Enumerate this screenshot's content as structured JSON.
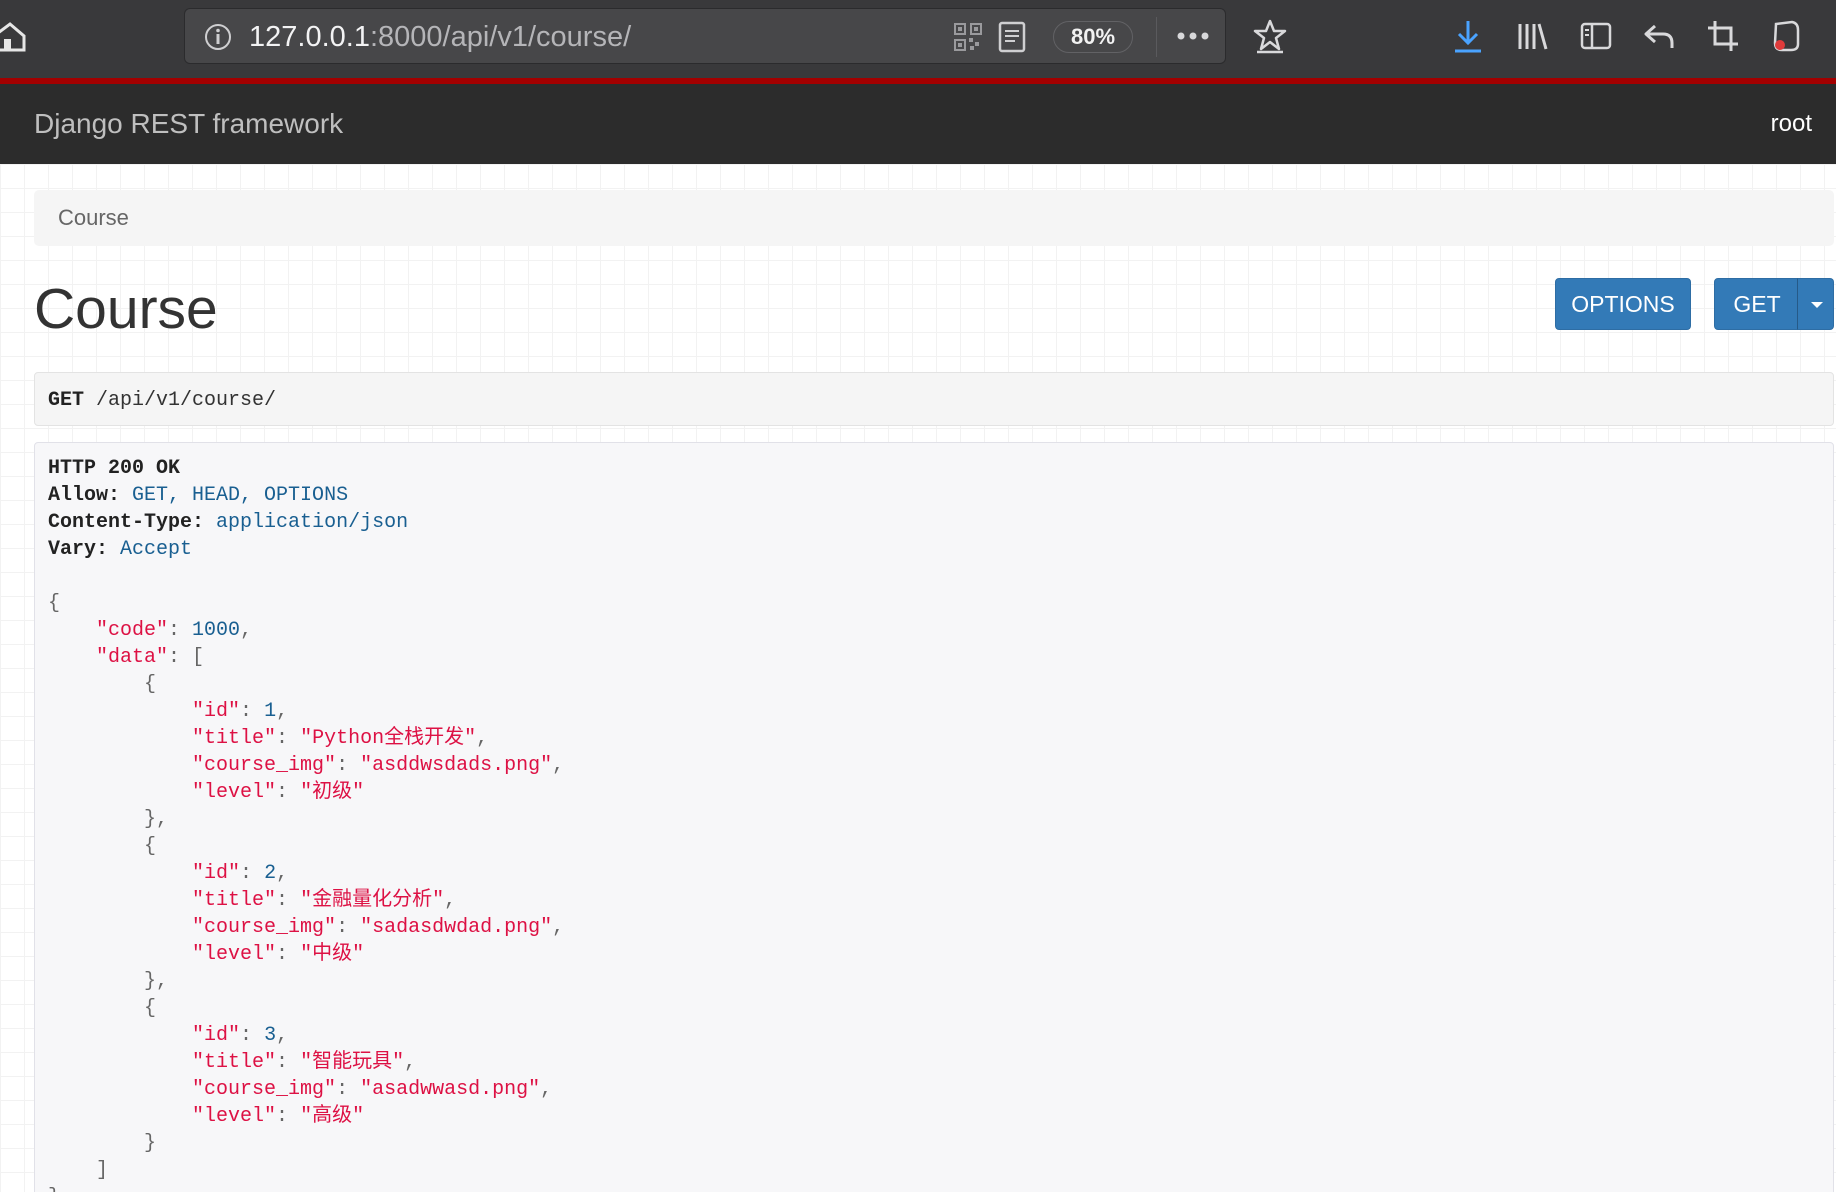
{
  "browser": {
    "url_host": "127.0.0.1",
    "url_rest": ":8000/api/v1/course/",
    "zoom": "80%"
  },
  "navbar": {
    "brand": "Django REST framework",
    "user": "root"
  },
  "breadcrumb": [
    "Course"
  ],
  "page": {
    "title": "Course",
    "options_label": "OPTIONS",
    "get_label": "GET"
  },
  "request": {
    "method": "GET",
    "path": "/api/v1/course/"
  },
  "response": {
    "status": "HTTP 200 OK",
    "headers": [
      {
        "name": "Allow",
        "value": "GET, HEAD, OPTIONS"
      },
      {
        "name": "Content-Type",
        "value": "application/json"
      },
      {
        "name": "Vary",
        "value": "Accept"
      }
    ],
    "code": 1000,
    "data": [
      {
        "id": 1,
        "title": "Python全栈开发",
        "course_img": "asddwsdads.png",
        "level": "初级"
      },
      {
        "id": 2,
        "title": "金融量化分析",
        "course_img": "sadasdwdad.png",
        "level": "中级"
      },
      {
        "id": 3,
        "title": "智能玩具",
        "course_img": "asadwwasd.png",
        "level": "高级"
      }
    ]
  },
  "colors": {
    "chrome": "#39393b",
    "navbar": "#2c2c2c",
    "accent_red": "#a30000",
    "button": "#337ab7",
    "json_string": "#dd1144",
    "json_literal": "#195f91"
  }
}
